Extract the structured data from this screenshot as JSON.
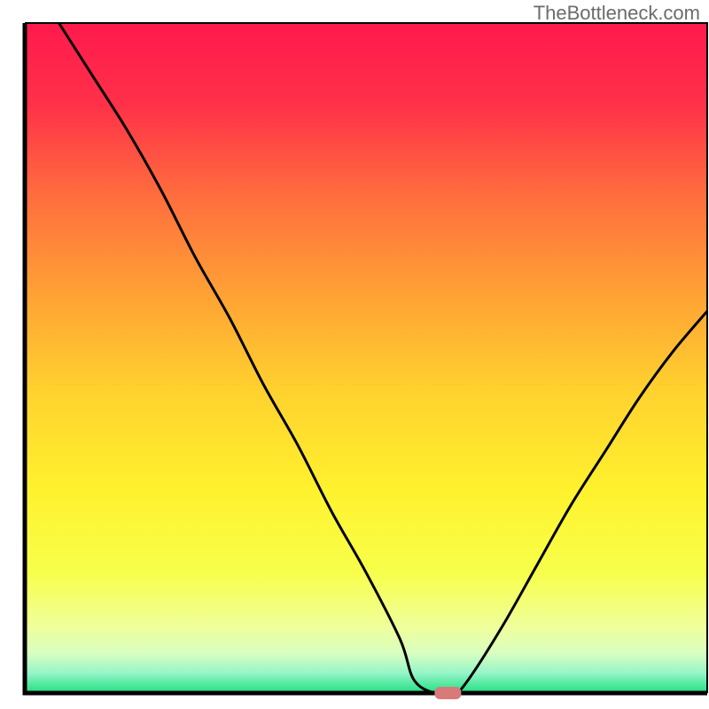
{
  "watermark": "TheBottleneck.com",
  "chart_data": {
    "type": "line",
    "title": "",
    "xlabel": "",
    "ylabel": "",
    "xlim": [
      0,
      100
    ],
    "ylim": [
      0,
      100
    ],
    "series": [
      {
        "name": "bottleneck-curve",
        "color": "#000000",
        "x": [
          5,
          10,
          15,
          20,
          25,
          30,
          35,
          40,
          45,
          50,
          55,
          57,
          60,
          63,
          65,
          70,
          75,
          80,
          85,
          90,
          95,
          100
        ],
        "y": [
          100,
          92,
          84,
          75,
          65,
          56,
          46,
          37,
          27,
          18,
          8,
          2,
          0,
          0,
          2,
          10,
          19,
          28,
          36,
          44,
          51,
          57
        ]
      }
    ],
    "marker": {
      "x": 62,
      "y": 0,
      "color": "#d97a7a",
      "shape": "rounded-rect"
    },
    "background_gradient": {
      "type": "vertical",
      "stops": [
        {
          "pos": 0.0,
          "color": "#ff1a4d"
        },
        {
          "pos": 0.12,
          "color": "#ff3049"
        },
        {
          "pos": 0.25,
          "color": "#ff6a3e"
        },
        {
          "pos": 0.4,
          "color": "#ffa035"
        },
        {
          "pos": 0.55,
          "color": "#ffd22e"
        },
        {
          "pos": 0.7,
          "color": "#fff22e"
        },
        {
          "pos": 0.82,
          "color": "#f7ff4a"
        },
        {
          "pos": 0.9,
          "color": "#f0ff9a"
        },
        {
          "pos": 0.94,
          "color": "#d9ffc0"
        },
        {
          "pos": 0.97,
          "color": "#96f5c8"
        },
        {
          "pos": 1.0,
          "color": "#1ee080"
        }
      ]
    },
    "axes_color": "#000000"
  }
}
